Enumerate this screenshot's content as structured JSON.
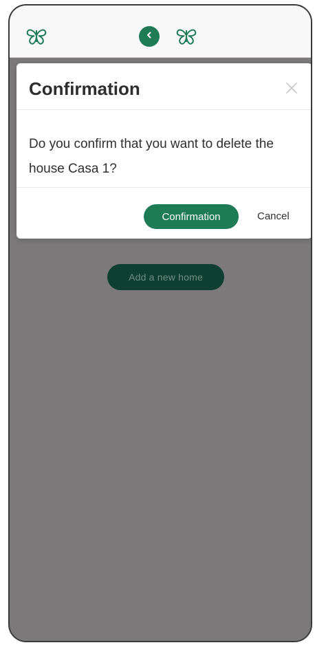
{
  "header": {
    "back_icon": "back-arrow-icon"
  },
  "main": {
    "add_home_button_label": "Add a new home"
  },
  "dialog": {
    "title": "Confirmation",
    "message": "Do you confirm that you want to delete the house Casa 1?",
    "confirm_label": "Confirmation",
    "cancel_label": "Cancel"
  },
  "colors": {
    "brand_green": "#1f7a56",
    "dark_green": "#0f3f31",
    "overlay_gray": "#7b7979",
    "panel_white": "#ffffff"
  }
}
